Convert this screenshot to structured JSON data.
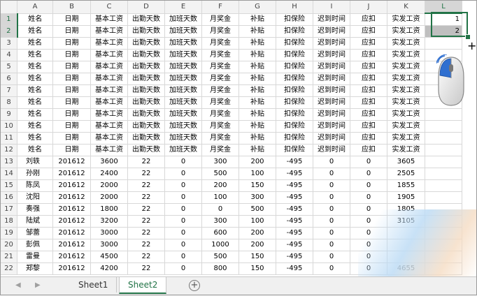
{
  "columns": [
    "A",
    "B",
    "C",
    "D",
    "E",
    "F",
    "G",
    "H",
    "I",
    "J",
    "K",
    "L"
  ],
  "header_row": [
    "姓名",
    "日期",
    "基本工资",
    "出勤天数",
    "加班天数",
    "月奖金",
    "补贴",
    "扣保险",
    "迟到时间",
    "应扣",
    "实发工资"
  ],
  "header_rows_count": 12,
  "data_rows": [
    [
      "刘轶",
      "201612",
      "3600",
      "22",
      "0",
      "300",
      "200",
      "-495",
      "0",
      "0",
      "3605"
    ],
    [
      "孙刚",
      "201612",
      "2400",
      "22",
      "0",
      "500",
      "100",
      "-495",
      "0",
      "0",
      "2505"
    ],
    [
      "陈凤",
      "201612",
      "2000",
      "22",
      "0",
      "200",
      "150",
      "-495",
      "0",
      "0",
      "1855"
    ],
    [
      "沈阳",
      "201612",
      "2000",
      "22",
      "0",
      "100",
      "300",
      "-495",
      "0",
      "0",
      "1905"
    ],
    [
      "奏强",
      "201612",
      "1800",
      "22",
      "0",
      "0",
      "500",
      "-495",
      "0",
      "0",
      "1805"
    ],
    [
      "陆斌",
      "201612",
      "3200",
      "22",
      "0",
      "300",
      "100",
      "-495",
      "0",
      "0",
      "3105"
    ],
    [
      "邹蕾",
      "201612",
      "3000",
      "22",
      "0",
      "600",
      "200",
      "-495",
      "0",
      "0",
      ""
    ],
    [
      "彭佩",
      "201612",
      "3000",
      "22",
      "0",
      "1000",
      "200",
      "-495",
      "0",
      "0",
      ""
    ],
    [
      "雷曼",
      "201612",
      "4500",
      "22",
      "0",
      "500",
      "150",
      "-495",
      "0",
      "0",
      ""
    ],
    [
      "郑黎",
      "201612",
      "4200",
      "22",
      "0",
      "800",
      "150",
      "-495",
      "0",
      "0",
      "4655"
    ]
  ],
  "l_values": [
    "1",
    "2"
  ],
  "tabs": {
    "sheet1": "Sheet1",
    "sheet2": "Sheet2",
    "add": "+"
  },
  "nav": {
    "prev": "◀",
    "next": "▶"
  },
  "crosshair": "+",
  "colors": {
    "accent": "#217346",
    "header_bg": "#f3f3f3",
    "grid": "#d8d8d8"
  }
}
